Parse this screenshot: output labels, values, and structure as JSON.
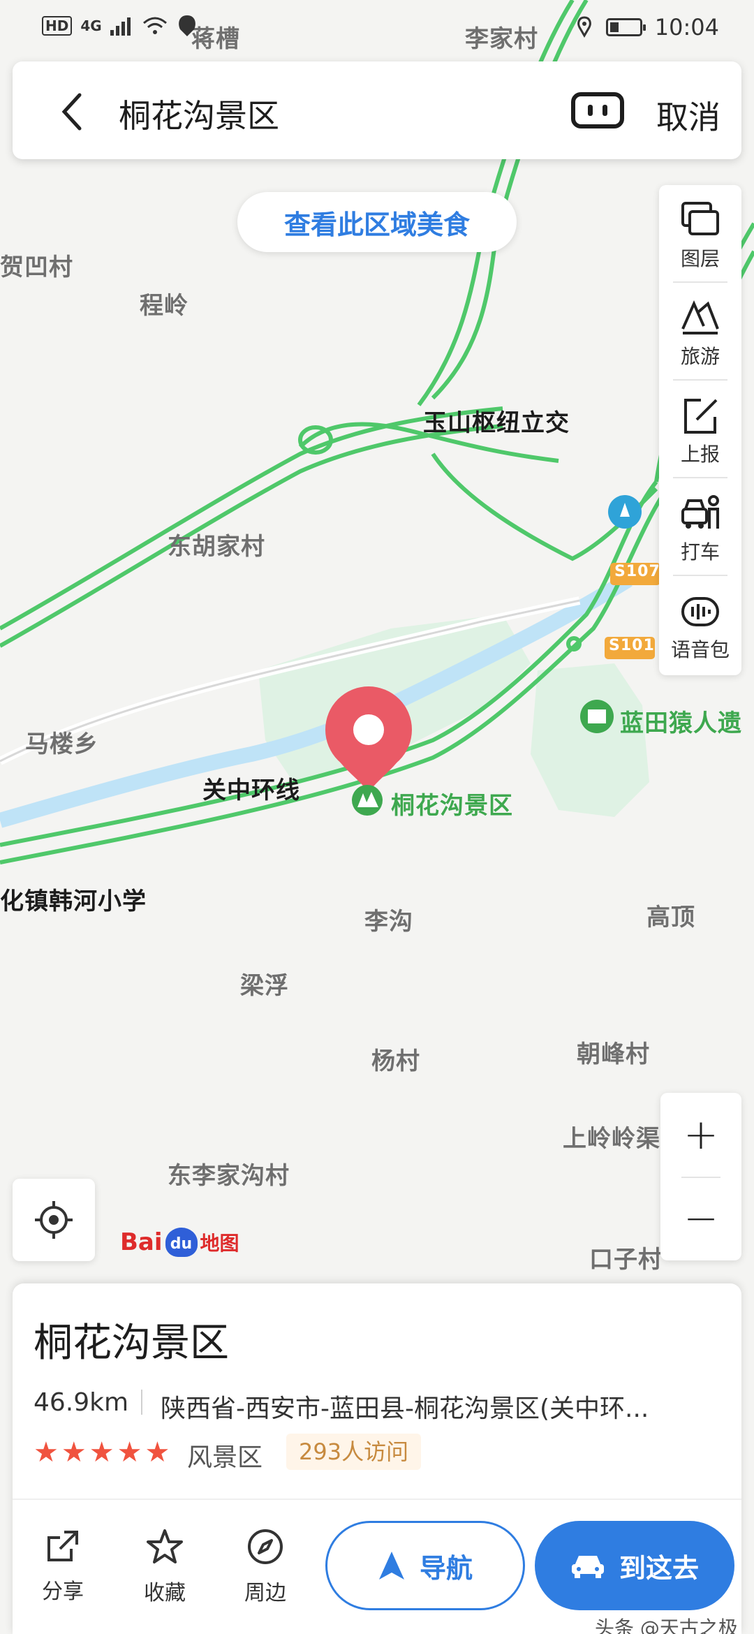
{
  "status_bar": {
    "hd": "HD",
    "network": "4G",
    "time": "10:04"
  },
  "search": {
    "query": "桐花沟景区",
    "cancel": "取消"
  },
  "food_button": "查看此区域美食",
  "tools": [
    {
      "label": "图层",
      "icon": "layers-icon"
    },
    {
      "label": "旅游",
      "icon": "travel-icon"
    },
    {
      "label": "上报",
      "icon": "report-icon"
    },
    {
      "label": "打车",
      "icon": "taxi-icon"
    },
    {
      "label": "语音包",
      "icon": "voice-pack-icon"
    }
  ],
  "map_labels": {
    "jiangcao": "蒋槽",
    "lijiacun": "李家村",
    "heaocun": "贺凹村",
    "chengling": "程岭",
    "yushan": "玉山枢纽立交",
    "donghujia": "东胡家村",
    "malouxiang": "马楼乡",
    "guanzhong": "关中环线",
    "tonghua": "桐花沟景区",
    "lantian": "蓝田猿人遗",
    "hanhe": "化镇韩河小学",
    "ligou": "李沟",
    "gaoding": "高顶",
    "liangfu": "梁浮",
    "yangcun": "杨村",
    "chaofeng": "朝峰村",
    "shangling": "上岭岭渠",
    "donglijia": "东李家沟村",
    "kouzi": "口子村",
    "s107": "S107",
    "s101": "S101"
  },
  "zoom": {
    "in": "+",
    "out": "−"
  },
  "baidu": {
    "bai": "Bai",
    "du": "du",
    "map": "地图"
  },
  "card": {
    "title": "桐花沟景区",
    "distance": "46.9km",
    "address": "陕西省-西安市-蓝田县-桐花沟景区(关中环...",
    "rating": 5,
    "category": "风景区",
    "visits": "293人访问",
    "actions": {
      "share": "分享",
      "favorite": "收藏",
      "nearby": "周边"
    },
    "navigate": "导航",
    "go": "到这去"
  },
  "watermark": "头条 @天古之极",
  "colors": {
    "accent": "#2f7de1",
    "road": "#4fc86a",
    "river": "#bfe3f7",
    "pin": "#ea5a66"
  }
}
